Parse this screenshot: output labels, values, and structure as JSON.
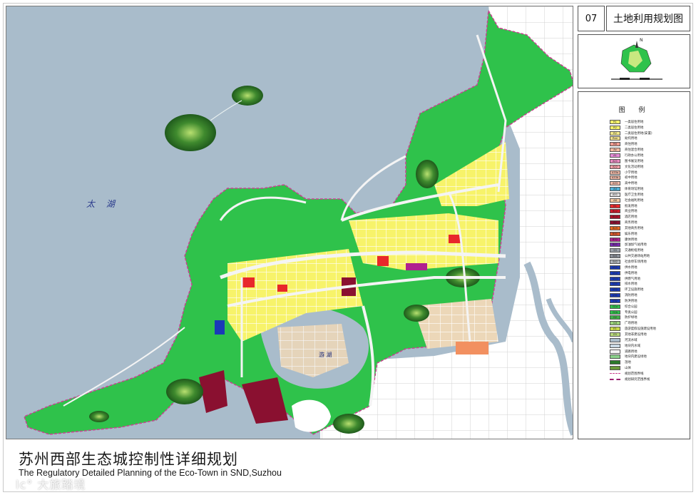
{
  "plan": {
    "number": "07",
    "map_title": "土地利用规划图",
    "title_cn": "苏州西部生态城控制性详细规划",
    "title_en": "The Regulatory Detailed Planning of the Eco-Town in SND,Suzhou"
  },
  "map": {
    "lake_label": "太 湖",
    "small_lake_label": "游 湖",
    "colors": {
      "water": "#a9bccb",
      "greenland": "#2fc24b",
      "forest": "#1f6b24",
      "road": "#f4f4f4",
      "residential": "#f7f36a",
      "commercial": "#e8282b",
      "public": "#f2a7a0",
      "institutional": "#8a1030",
      "school": "#e6b8a8",
      "industrial": "#b07a3a",
      "boundary": "#c8428f"
    }
  },
  "compass": {
    "north_label": "N"
  },
  "legend": {
    "title": "图 例",
    "items": [
      {
        "code": "R1",
        "label": "一类居住用地",
        "color": "#f7f36a"
      },
      {
        "code": "R2",
        "label": "二类居住用地",
        "color": "#f7f36a"
      },
      {
        "code": "R2",
        "label": "二类居住用地(安置)",
        "color": "#f2e98a"
      },
      {
        "code": "Rxx",
        "label": "幼托用地",
        "color": "#f0e08c"
      },
      {
        "code": "RB",
        "label": "商住用地",
        "color": "#f29a8f"
      },
      {
        "code": "Ax",
        "label": "商住混合用地",
        "color": "#f2b8a0"
      },
      {
        "code": "A1",
        "label": "行政办公用地",
        "color": "#e58ad6"
      },
      {
        "code": "A21",
        "label": "图书展览用地",
        "color": "#e98ac0"
      },
      {
        "code": "A22",
        "label": "文化活动用地",
        "color": "#f29ca6"
      },
      {
        "code": "A33a",
        "label": "小学用地",
        "color": "#f0b8a6"
      },
      {
        "code": "A33b",
        "label": "初中用地",
        "color": "#f0b8a6"
      },
      {
        "code": "A33",
        "label": "高中用地",
        "color": "#f0b8a6"
      },
      {
        "code": "A4",
        "label": "体育场馆用地",
        "color": "#4fb0d8"
      },
      {
        "code": "A51",
        "label": "医疗卫生用地",
        "color": "#e0e0e0"
      },
      {
        "code": "A6",
        "label": "社会福利用地",
        "color": "#f2c8a0"
      },
      {
        "code": "B1",
        "label": "批发用地",
        "color": "#e8282b"
      },
      {
        "code": "B12",
        "label": "商业用地",
        "color": "#d01a2a"
      },
      {
        "code": "B14",
        "label": "酒店用地",
        "color": "#b01028"
      },
      {
        "code": "B2",
        "label": "商务用地",
        "color": "#8a1030"
      },
      {
        "code": "B29",
        "label": "其他商务用地",
        "color": "#e86a20"
      },
      {
        "code": "B31",
        "label": "娱乐用地",
        "color": "#d8562a"
      },
      {
        "code": "B32",
        "label": "康体用地",
        "color": "#b02090"
      },
      {
        "code": "B41",
        "label": "加油加气站用地",
        "color": "#7a2ab0"
      },
      {
        "code": "S3",
        "label": "交通枢纽用地",
        "color": "#9aa0a8"
      },
      {
        "code": "S41",
        "label": "公共交通场站用地",
        "color": "#8a8f98"
      },
      {
        "code": "S42",
        "label": "社会停车场用地",
        "color": "#b0b4ba"
      },
      {
        "code": "U11",
        "label": "供水用地",
        "color": "#1a3ab8"
      },
      {
        "code": "U12",
        "label": "供电用地",
        "color": "#1a3ab8"
      },
      {
        "code": "U13",
        "label": "供燃气用地",
        "color": "#1a3ab8"
      },
      {
        "code": "U21",
        "label": "排水用地",
        "color": "#1a3ab8"
      },
      {
        "code": "U22",
        "label": "环卫设施用地",
        "color": "#1a3ab8"
      },
      {
        "code": "U31",
        "label": "消防用地",
        "color": "#1a3ab8"
      },
      {
        "code": "U32",
        "label": "防洪用地",
        "color": "#1a3ab8"
      },
      {
        "code": "G1a",
        "label": "综合公园",
        "color": "#2fc24b"
      },
      {
        "code": "G1b",
        "label": "专类公园",
        "color": "#2fc24b"
      },
      {
        "code": "G2",
        "label": "防护绿地",
        "color": "#3fb048"
      },
      {
        "code": "G3",
        "label": "广场用地",
        "color": "#9ad27a"
      },
      {
        "code": "E1",
        "label": "旅游度假设施建设用地",
        "color": "#c8d84a"
      },
      {
        "code": "E9",
        "label": "其他非建设用地",
        "color": "#b8d87a"
      },
      {
        "code": "",
        "label": "河流水域",
        "color": "#a9bccb"
      },
      {
        "code": "",
        "label": "地块内水域",
        "color": "#c8d8e4"
      },
      {
        "code": "",
        "label": "道路用地",
        "color": "#f4f4f4"
      },
      {
        "code": "",
        "label": "地块内建设绿地",
        "color": "#8ad08a"
      },
      {
        "code": "",
        "label": "湿地",
        "color": "#2a7a2a"
      },
      {
        "code": "",
        "label": "山体",
        "color": "#6a9a3a"
      },
      {
        "code": "",
        "label": "规划范围界线",
        "color": "#ffffff"
      },
      {
        "code": "",
        "label": "规划研究范围界线",
        "color": "#ffffff"
      }
    ]
  },
  "watermark": "lc° 大旅踏境"
}
